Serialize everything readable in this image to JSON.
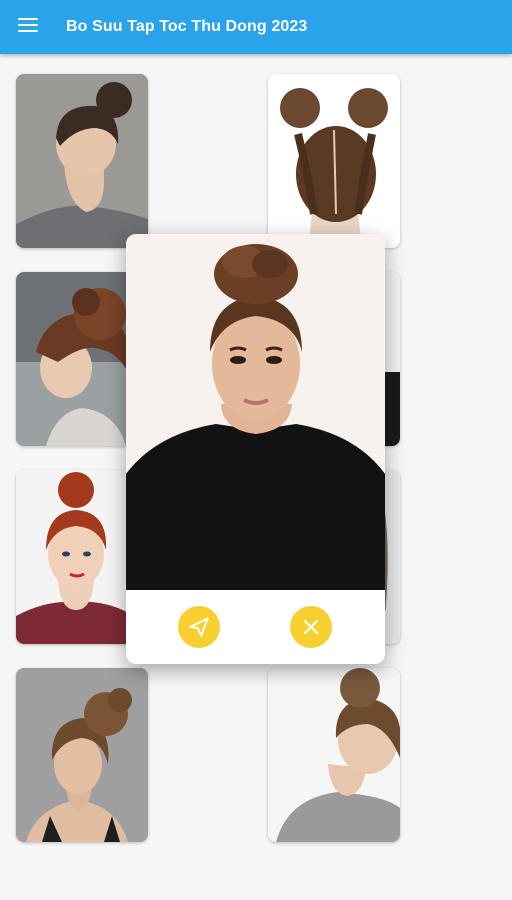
{
  "app": {
    "title": "Bo Suu Tap Toc Thu Dong 2023",
    "menu_icon": "hamburger-menu-icon"
  },
  "gallery": {
    "tiles": [
      {
        "id": "tile-1",
        "bg": "#8a8a86",
        "hair": "#3a2c22",
        "shirt": "#6d6f73"
      },
      {
        "id": "tile-2",
        "bg": "#ffffff",
        "hair": "#5a3a24",
        "shirt": "#e8e1d8"
      },
      {
        "id": "tile-3",
        "bg": "#6e7276",
        "hair": "#6b3a25",
        "shirt": "#d9d6d2"
      },
      {
        "id": "tile-4",
        "bg": "#f2f2f2",
        "hair": "#3d2b20",
        "shirt": "#1a1a1a"
      },
      {
        "id": "tile-5",
        "bg": "#f4f4f4",
        "hair": "#a33a1e",
        "shirt": "#7d2a36"
      },
      {
        "id": "tile-6",
        "bg": "#e9e9e9",
        "hair": "#4a3526",
        "shirt": "#cfcfcf"
      },
      {
        "id": "tile-7",
        "bg": "#9b9b9b",
        "hair": "#6e4a2c",
        "shirt": "#1e1e1e"
      },
      {
        "id": "tile-8",
        "bg": "#f6f6f6",
        "hair": "#7a5a3c",
        "shirt": "#9a9a9a"
      }
    ]
  },
  "preview_dialog": {
    "photo": {
      "bg": "#f7f1ee",
      "hair": "#5a3520",
      "shirt": "#121212"
    },
    "actions": [
      {
        "name": "send-button",
        "icon": "send-icon",
        "color": "#f7cf2e"
      },
      {
        "name": "close-button",
        "icon": "close-icon",
        "color": "#f7cf2e"
      }
    ]
  }
}
